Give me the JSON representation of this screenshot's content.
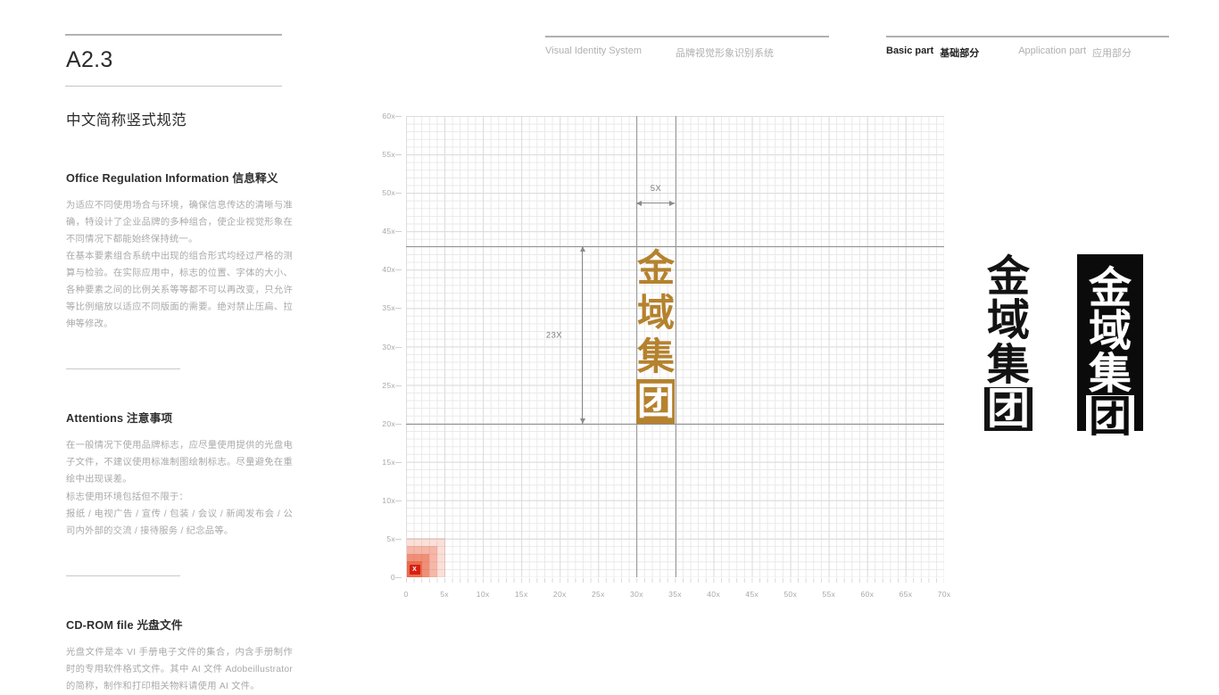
{
  "header": {
    "left_group": {
      "en": "Visual Identity System",
      "cn": "品牌视觉形象识别系统"
    },
    "right_group": {
      "basic_en": "Basic part",
      "basic_cn": "基础部分",
      "application_en": "Application part",
      "application_cn": "应用部分"
    }
  },
  "left": {
    "section_number": "A2.3",
    "page_subtitle": "中文简称竖式规范",
    "blocks": [
      {
        "title_en": "Office Regulation Information",
        "title_cn": "信息释义",
        "paragraphs": [
          "为适应不同使用场合与环境，确保信息传达的清晰与准确，特设计了企业品牌的多种组合，使企业视觉形象在不同情况下都能始终保持统一。",
          "在基本要素组合系统中出现的组合形式均经过严格的测算与检验。在实际应用中，标志的位置、字体的大小、各种要素之间的比例关系等等都不可以再改变，只允许等比例缩放以适应不同版面的需要。绝对禁止压扁、拉伸等修改。"
        ]
      },
      {
        "title_en": "Attentions",
        "title_cn": "注意事项",
        "paragraphs": [
          "在一般情况下使用品牌标志，应尽量使用提供的光盘电子文件，不建议使用标准制图绘制标志。尽量避免在重绘中出现误差。",
          "标志使用环境包括但不限于：",
          "报纸 / 电视广告 / 宣传 / 包装 / 会议 / 新闻发布会 / 公司内外部的交流 / 接待服务 / 纪念品等。"
        ]
      },
      {
        "title_en": "CD-ROM file",
        "title_cn": "光盘文件",
        "paragraphs": [
          "光盘文件是本 VI 手册电子文件的集合，内含手册制作时的专用软件格式文件。其中 AI 文件 Adobeillustrator 的简称，制作和打印相关物料请使用 AI 文件。"
        ]
      }
    ]
  },
  "logo": {
    "characters": [
      "金",
      "域",
      "集",
      "团"
    ],
    "gold_color": "#b5822e",
    "mono_color": "#131313",
    "inverted_bg": "#0b0b0b"
  },
  "annotations": {
    "width_label": "5X",
    "height_label": "23X",
    "unit_chip": "X"
  },
  "chart_data": {
    "type": "scatter",
    "title": "",
    "xlabel": "",
    "ylabel": "",
    "xlim": [
      0,
      70
    ],
    "ylim": [
      0,
      60
    ],
    "grid": true,
    "minor_step": 1,
    "major_step": 5,
    "x_ticks": [
      "0",
      "5x",
      "10x",
      "15x",
      "20x",
      "25x",
      "30x",
      "35x",
      "40x",
      "45x",
      "50x",
      "55x",
      "60x",
      "65x",
      "70x"
    ],
    "x_tick_values": [
      0,
      5,
      10,
      15,
      20,
      25,
      30,
      35,
      40,
      45,
      50,
      55,
      60,
      65,
      70
    ],
    "y_ticks": [
      "0",
      "5x",
      "10x",
      "15x",
      "20x",
      "25x",
      "30x",
      "35x",
      "40x",
      "45x",
      "50x",
      "55x",
      "60x"
    ],
    "y_tick_values": [
      0,
      5,
      10,
      15,
      20,
      25,
      30,
      35,
      40,
      45,
      50,
      55,
      60
    ],
    "reference_lines": {
      "horizontal": [
        43,
        20
      ],
      "vertical": [
        30,
        35
      ]
    },
    "logo_bounds": {
      "x_start": 30,
      "x_end": 35,
      "y_bottom": 20,
      "y_top": 43,
      "width_units": 5,
      "height_units": 23
    },
    "unit_swatch": {
      "x": 0,
      "y": 0,
      "size_units": 5,
      "steps": [
        5,
        4,
        3,
        2
      ],
      "color": "#e8502a",
      "chip_color": "#d81f12"
    }
  }
}
